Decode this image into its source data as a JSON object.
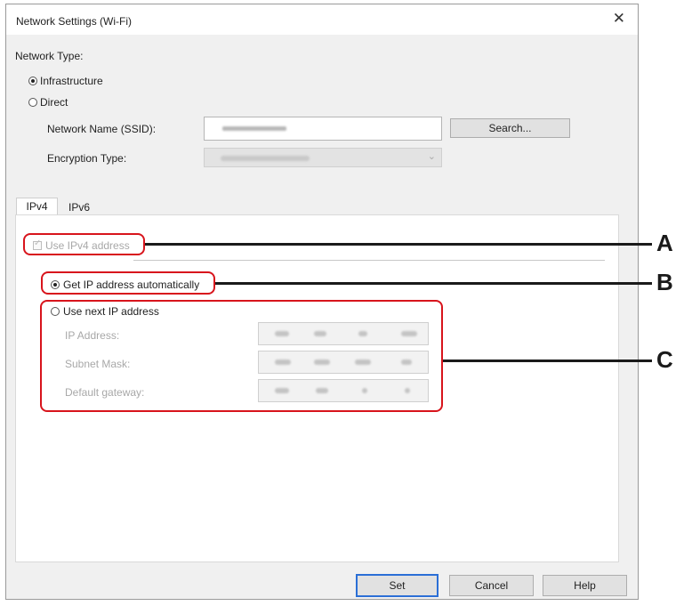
{
  "window": {
    "title": "Network Settings (Wi-Fi)",
    "close_icon": "close-icon"
  },
  "network_type": {
    "label": "Network Type:",
    "options": [
      {
        "label": "Infrastructure",
        "selected": true
      },
      {
        "label": "Direct",
        "selected": false
      }
    ]
  },
  "ssid": {
    "label": "Network Name (SSID):",
    "search_button": "Search..."
  },
  "encryption": {
    "label": "Encryption Type:"
  },
  "tabs": [
    {
      "label": "IPv4",
      "active": true
    },
    {
      "label": "IPv6",
      "active": false
    }
  ],
  "ipv4": {
    "use_ipv4_label": "Use IPv4 address",
    "auto_label": "Get IP address automatically",
    "manual_label": "Use next IP address",
    "ip_label": "IP Address:",
    "subnet_label": "Subnet Mask:",
    "gateway_label": "Default gateway:"
  },
  "buttons": {
    "set": "Set",
    "cancel": "Cancel",
    "help": "Help"
  },
  "callouts": {
    "a": "A",
    "b": "B",
    "c": "C"
  },
  "colors": {
    "highlight": "#d8141c",
    "default_button_border": "#2b6fd6"
  }
}
